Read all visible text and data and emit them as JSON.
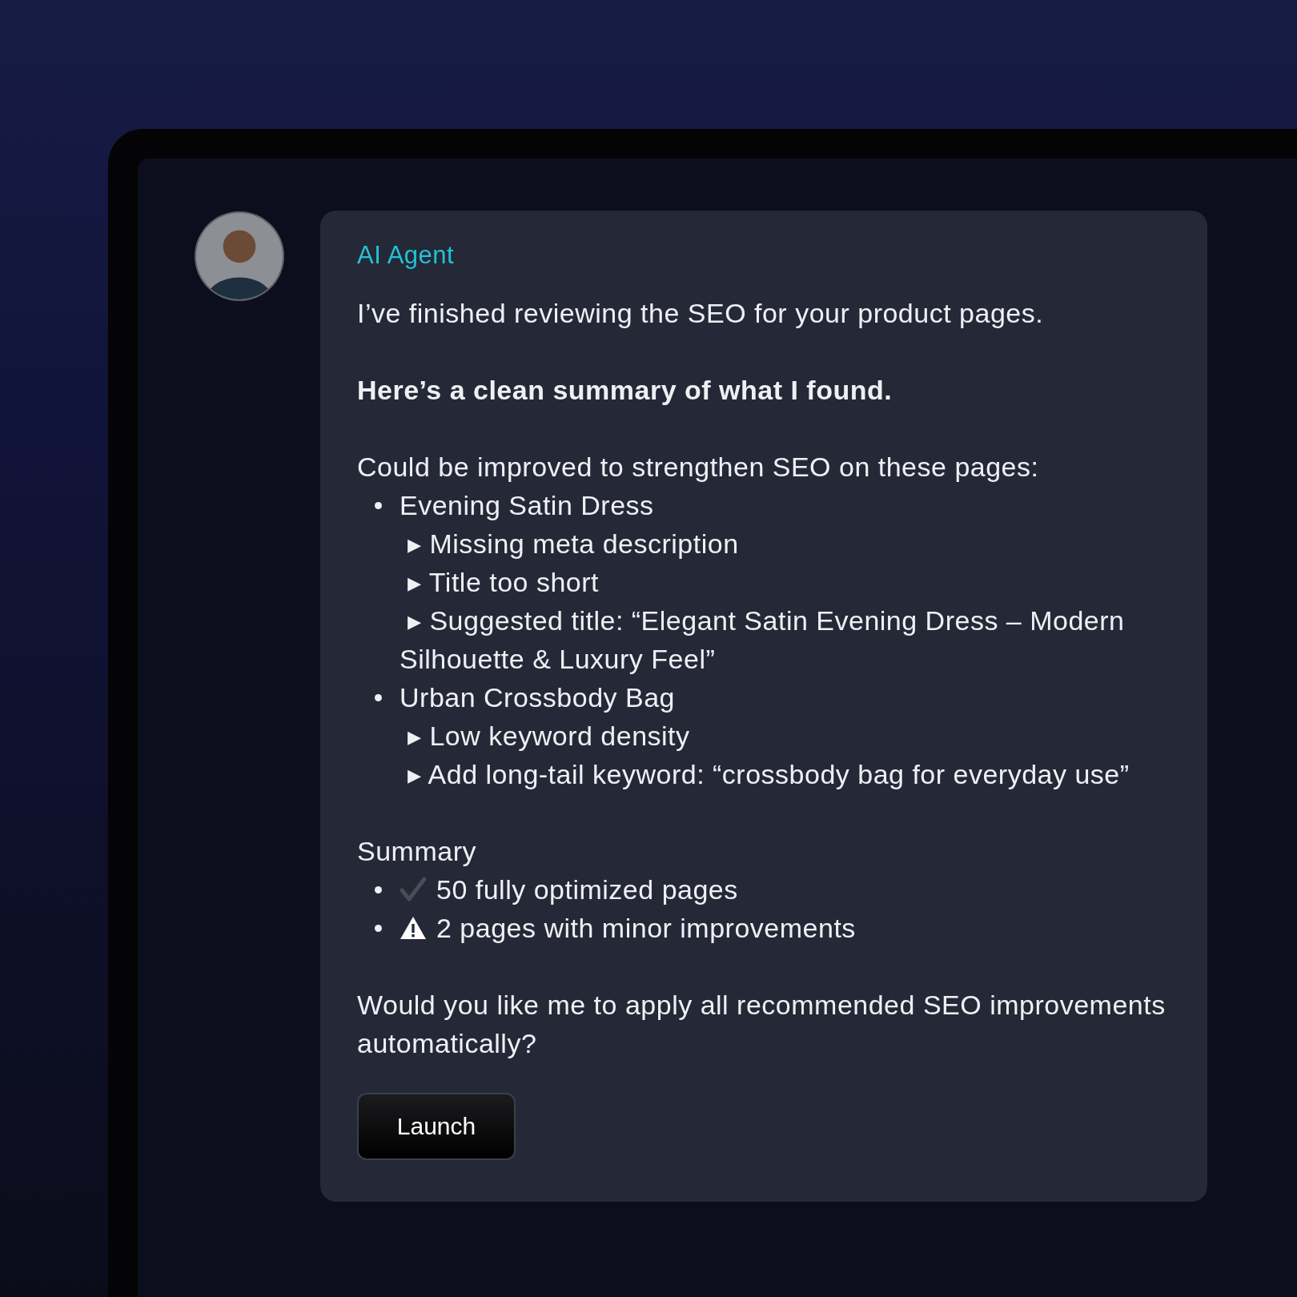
{
  "message": {
    "sender": "AI Agent",
    "intro": "I’ve finished reviewing the SEO for your product pages.",
    "heading": "Here’s a clean summary of what I found.",
    "issues_heading": "Could be improved to strengthen SEO on these pages:",
    "issues": [
      {
        "page": "Evening Satin Dress",
        "notes": [
          "▸ Missing meta description",
          "▸ Title too short",
          "▸ Suggested title: “Elegant Satin Evening Dress – Modern Silhouette & Luxury Feel”"
        ]
      },
      {
        "page": "Urban Crossbody Bag",
        "notes": [
          "▸ Low keyword density",
          "▸ Add long-tail keyword: “crossbody bag for everyday use”"
        ]
      }
    ],
    "summary_heading": "Summary",
    "summary_items": [
      {
        "kind": "check",
        "text": "50 fully optimized pages"
      },
      {
        "kind": "warning",
        "text": "2 pages with minor improvements"
      }
    ],
    "question": "Would you like me to apply all recommended SEO improvements automatically?",
    "action_button": "Launch"
  }
}
